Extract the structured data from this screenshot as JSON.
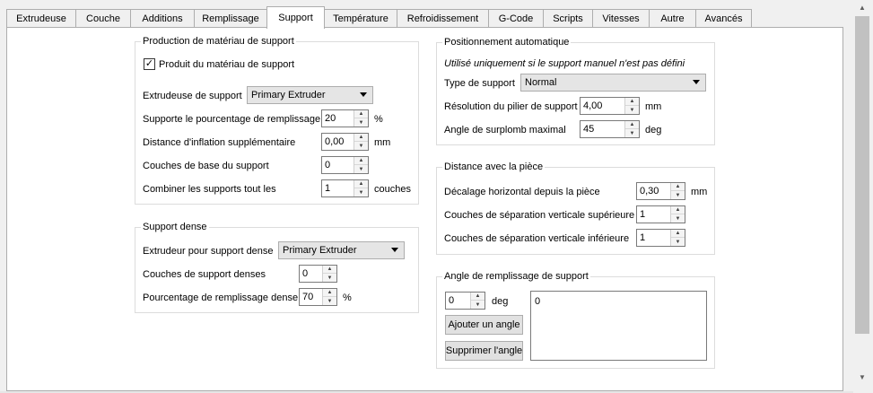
{
  "tabs": [
    {
      "label": "Extrudeuse",
      "active": false
    },
    {
      "label": "Couche",
      "active": false
    },
    {
      "label": "Additions",
      "active": false
    },
    {
      "label": "Remplissage",
      "active": false
    },
    {
      "label": "Support",
      "active": true
    },
    {
      "label": "Température",
      "active": false
    },
    {
      "label": "Refroidissement",
      "active": false
    },
    {
      "label": "G-Code",
      "active": false
    },
    {
      "label": "Scripts",
      "active": false
    },
    {
      "label": "Vitesses",
      "active": false
    },
    {
      "label": "Autre",
      "active": false
    },
    {
      "label": "Avancés",
      "active": false
    }
  ],
  "production": {
    "title": "Production de matériau de support",
    "generate_label": "Produit du matériau de support",
    "generate_checked": "✓",
    "extruder_label": "Extrudeuse de support",
    "extruder_value": "Primary Extruder",
    "infill_label": "Supporte le pourcentage de remplissage",
    "infill_value": "20",
    "infill_unit": "%",
    "inflation_label": "Distance d'inflation supplémentaire",
    "inflation_value": "0,00",
    "inflation_unit": "mm",
    "base_layers_label": "Couches de base du support",
    "base_layers_value": "0",
    "combine_label": "Combiner les supports tout les",
    "combine_value": "1",
    "combine_unit": "couches"
  },
  "dense": {
    "title": "Support dense",
    "extruder_label": "Extrudeur pour support dense",
    "extruder_value": "Primary Extruder",
    "layers_label": "Couches de support denses",
    "layers_value": "0",
    "infill_label": "Pourcentage de remplissage dense",
    "infill_value": "70",
    "infill_unit": "%"
  },
  "auto": {
    "title": "Positionnement automatique",
    "note": "Utilisé uniquement si le support manuel n'est pas défini",
    "type_label": "Type de support",
    "type_value": "Normal",
    "pillar_label": "Résolution du pilier de support",
    "pillar_value": "4,00",
    "pillar_unit": "mm",
    "overhang_label": "Angle de surplomb maximal",
    "overhang_value": "45",
    "overhang_unit": "deg"
  },
  "distance": {
    "title": "Distance avec la pièce",
    "horizontal_label": "Décalage horizontal depuis la pièce",
    "horizontal_value": "0,30",
    "horizontal_unit": "mm",
    "top_label": "Couches de séparation verticale supérieure",
    "top_value": "1",
    "bottom_label": "Couches de séparation verticale inférieure",
    "bottom_value": "1"
  },
  "angle": {
    "title": "Angle de remplissage de support",
    "angle_value": "0",
    "angle_unit": "deg",
    "add_label": "Ajouter un angle",
    "remove_label": "Supprimer l'angle",
    "list_items": [
      "0"
    ]
  }
}
